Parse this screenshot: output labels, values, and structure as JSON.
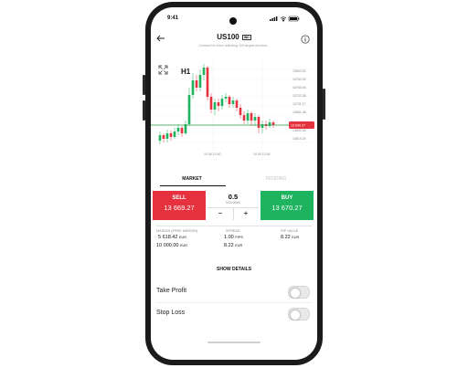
{
  "status_bar": {
    "time": "9:41"
  },
  "header": {
    "back_icon": "arrow-left-icon",
    "symbol": "US100",
    "badge": "IND",
    "subtitle": "Contract for index reflecting 100 largest America...",
    "info_icon": "info-icon"
  },
  "chart": {
    "timeframe": "H1",
    "expand_icon": "expand-icon",
    "price_labels": [
      "13803.52",
      "13763.30",
      "13743.04",
      "13723.38",
      "13701.17",
      "13681.48",
      "13649.27",
      "13633.05",
      "13619.20"
    ],
    "current_price": "13 649.27",
    "date_labels": [
      "10.05 12:00",
      "10.05 12:00"
    ],
    "colors": {
      "up": "#1db35f",
      "down": "#e5323e",
      "price_line": "#2e9a44"
    }
  },
  "order_tabs": {
    "market": "MARKET",
    "pending": "PENDING"
  },
  "trade": {
    "sell_label": "SELL",
    "sell_price": "13 669.27",
    "buy_label": "BUY",
    "buy_price": "13 670.27",
    "volume_value": "0.5",
    "volume_label": "VOLUME",
    "minus": "−",
    "plus": "+"
  },
  "details": {
    "margin_label": "MARGIN (FREE MARGIN)",
    "margin_value": "5 618.42",
    "margin_unit": "EUR",
    "free_margin_value": "10 000.00",
    "free_margin_unit": "EUR",
    "spread_label": "SPREAD",
    "spread_value": "1.00",
    "spread_unit": "PIPS",
    "spread_value2": "8.22",
    "spread_unit2": "EUR",
    "pip_label": "PIP VALUE",
    "pip_value": "8.22",
    "pip_unit": "EUR"
  },
  "show_details": "SHOW DETAILS",
  "toggles": {
    "take_profit": "Take Profit",
    "stop_loss": "Stop Loss"
  }
}
